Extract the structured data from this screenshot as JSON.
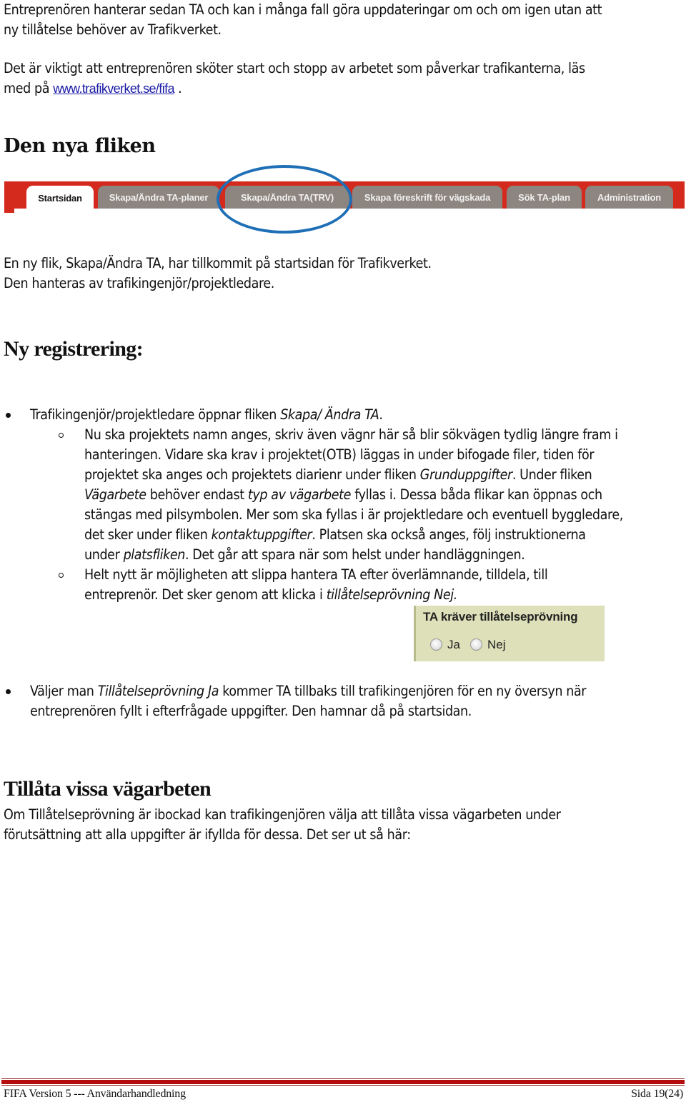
{
  "intro": {
    "p1_line1": "Entreprenören hanterar sedan TA och kan i många fall göra uppdateringar om och om igen utan att",
    "p1_line2": "ny tillåtelse behöver av Trafikverket.",
    "p2_line1": "Det är viktigt att entreprenören sköter start och stopp av arbetet som påverkar trafikanterna, läs",
    "p2_line2_prefix": "med på ",
    "p2_link": "www.trafikverket.se/fifa",
    "p2_line2_suffix": " ."
  },
  "section_new_tab": {
    "heading": "Den nya fliken",
    "tabs": [
      {
        "label": "Startsidan",
        "active": true
      },
      {
        "label": "Skapa/Ändra TA-planer",
        "active": false
      },
      {
        "label": "Skapa/Ändra TA(TRV)",
        "active": false,
        "highlighted": true
      },
      {
        "label": "Skapa föreskrift för vägskada",
        "active": false
      },
      {
        "label": "Sök TA-plan",
        "active": false
      },
      {
        "label": "Administration",
        "active": false
      }
    ],
    "tab_bar_color": "#d42a1e",
    "highlight_color": "#1f6fb6",
    "desc_line1": "En ny flik, Skapa/Ändra TA, har tillkommit på startsidan för Trafikverket.",
    "desc_line2": "Den hanteras av trafikingenjör/projektledare."
  },
  "section_registration": {
    "heading": "Ny registrering:",
    "bullet1": {
      "text_prefix": "Trafikingenjör/projektledare öppnar fliken ",
      "text_em": "Skapa/ Ändra TA",
      "text_suffix": ".",
      "sub1": {
        "l1": "Nu ska projektets namn anges, skriv även vägnr här så blir sökvägen tydlig längre fram i",
        "l2": "hanteringen. Vidare ska krav i projektet(OTB) läggas in under bifogade filer, tiden för",
        "l3_a": "projektet ska anges och projektets diarienr under fliken ",
        "l3_em": "Grunduppgifter",
        "l3_b": ". Under fliken",
        "l4_em1": "Vägarbete",
        "l4_a": " behöver endast ",
        "l4_em2": "typ av vägarbete",
        "l4_b": " fyllas i. Dessa båda flikar kan öppnas och",
        "l5": "stängas med pilsymbolen. Mer som ska fyllas i är projektledare och eventuell byggledare,",
        "l6_a": "det sker under fliken ",
        "l6_em": "kontaktuppgifter",
        "l6_b": ". Platsen ska också anges, följ instruktionerna",
        "l7_a": "under ",
        "l7_em": "platsfliken",
        "l7_b": ". Det går att spara när som helst under handläggningen."
      },
      "sub2": {
        "l1": "Helt nytt är möjligheten att slippa hantera TA efter överlämnande, tilldela, till",
        "l2_a": "entreprenör. Det sker genom att klicka i ",
        "l2_em": "tillåtelseprövning Nej."
      }
    },
    "widget": {
      "title": "TA kräver tillåtelseprövning",
      "options": [
        {
          "label": "Ja",
          "checked": false
        },
        {
          "label": "Nej",
          "checked": false
        }
      ]
    },
    "bullet2": {
      "l1_a": "Väljer man ",
      "l1_em": "Tillåtelseprövning Ja",
      "l1_b": " kommer TA tillbaks till trafikingenjören för en ny översyn när",
      "l2": "entreprenören fyllt i efterfrågade uppgifter. Den hamnar då på startsidan."
    }
  },
  "section_allow": {
    "heading": "Tillåta vissa vägarbeten",
    "l1": "Om Tillåtelseprövning är ibockad kan trafikingenjören välja att tillåta vissa vägarbeten under",
    "l2": "förutsättning att alla uppgifter är ifyllda för dessa. Det ser ut så här:"
  },
  "footer": {
    "left": "FIFA Version 5  --- Användarhandledning",
    "right": "Sida 19(24)"
  }
}
